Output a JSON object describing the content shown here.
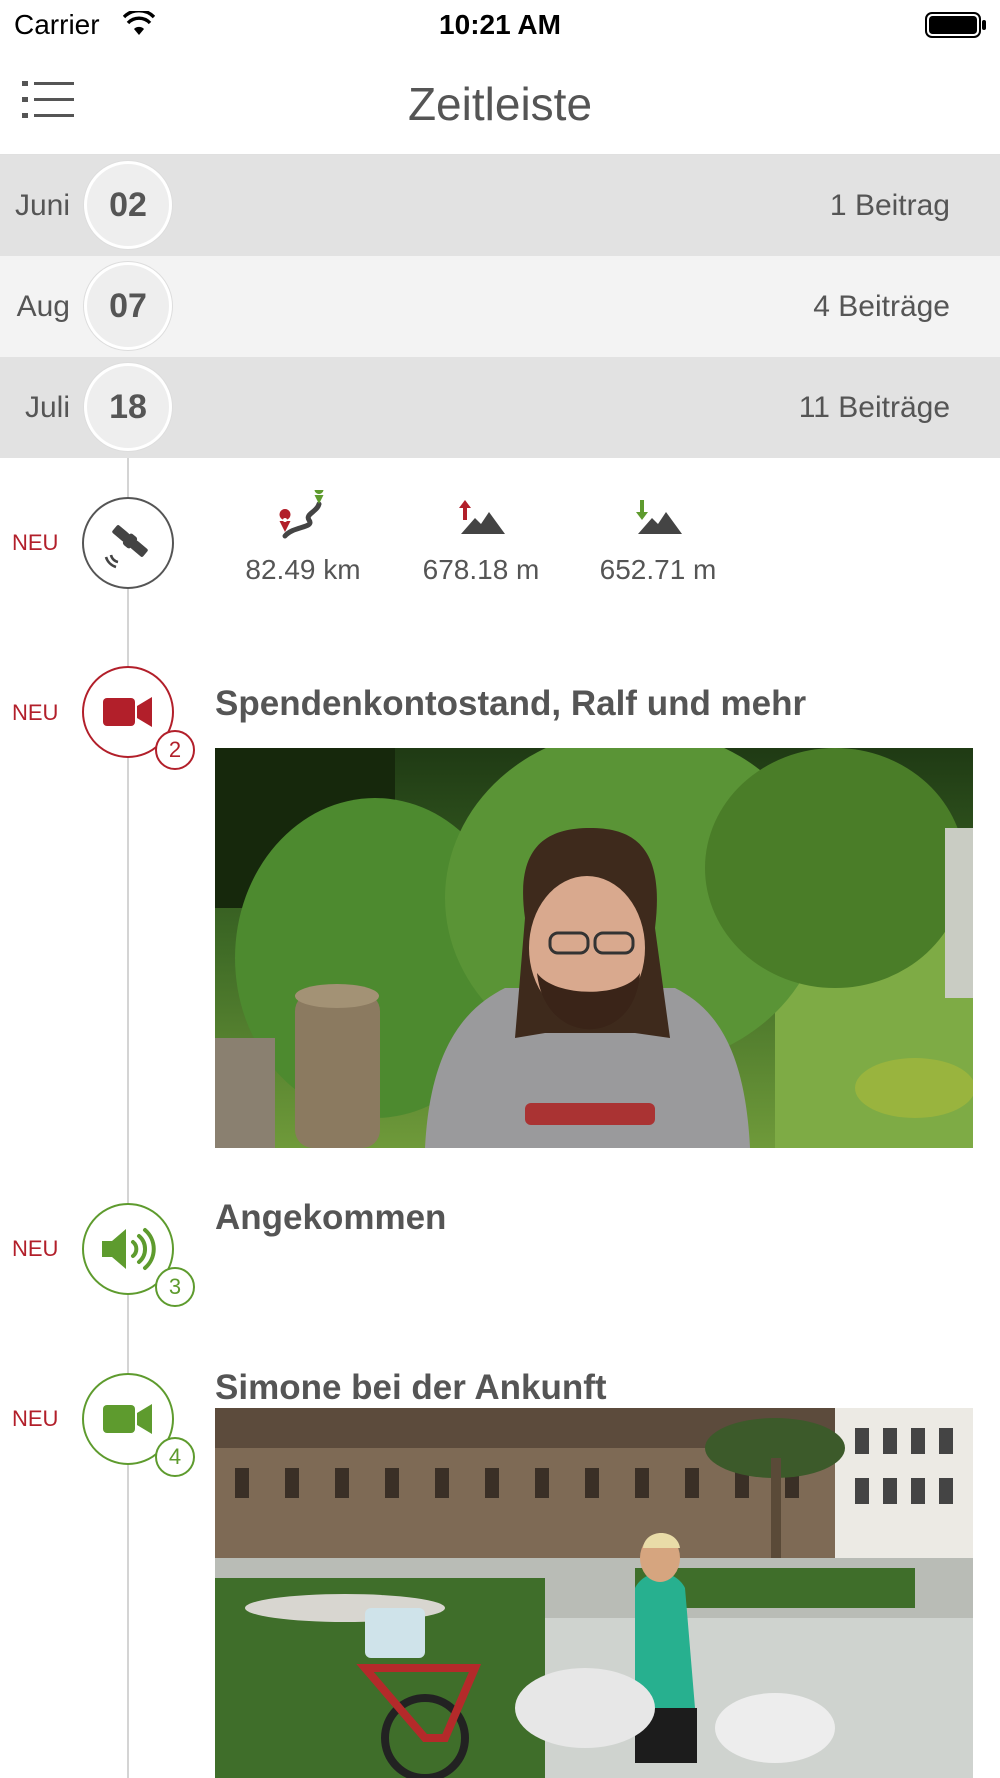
{
  "status_bar": {
    "carrier": "Carrier",
    "time": "10:21 AM",
    "icons": [
      "wifi-icon",
      "battery-icon"
    ]
  },
  "nav": {
    "title": "Zeitleiste",
    "menu_icon": "list-icon"
  },
  "date_groups": [
    {
      "month": "Juni",
      "day": "02",
      "count": "1 Beitrag",
      "bg": "#e2e2e2"
    },
    {
      "month": "Aug",
      "day": "07",
      "count": "4 Beiträge",
      "bg": "#f3f3f3"
    },
    {
      "month": "Juli",
      "day": "18",
      "count": "11 Beiträge",
      "bg": "#e2e2e2"
    }
  ],
  "entries": {
    "gps": {
      "new_label": "NEU",
      "icon": "satellite-icon",
      "stats": [
        {
          "icon": "route-icon",
          "value": "82.49 km"
        },
        {
          "icon": "ascent-icon",
          "value": "678.18 m"
        },
        {
          "icon": "descent-icon",
          "value": "652.71 m"
        }
      ]
    },
    "video1": {
      "new_label": "NEU",
      "icon": "video-camera-icon",
      "badge": "2",
      "title": "Spendenkontostand, Ralf und mehr"
    },
    "audio": {
      "new_label": "NEU",
      "icon": "speaker-icon",
      "badge": "3",
      "title": "Angekommen"
    },
    "video2": {
      "new_label": "NEU",
      "icon": "video-camera-icon",
      "badge": "4",
      "title": "Simone bei der Ankunft"
    }
  },
  "colors": {
    "accent_red": "#b21f2a",
    "accent_green": "#5e9b2e",
    "text": "#555555"
  }
}
